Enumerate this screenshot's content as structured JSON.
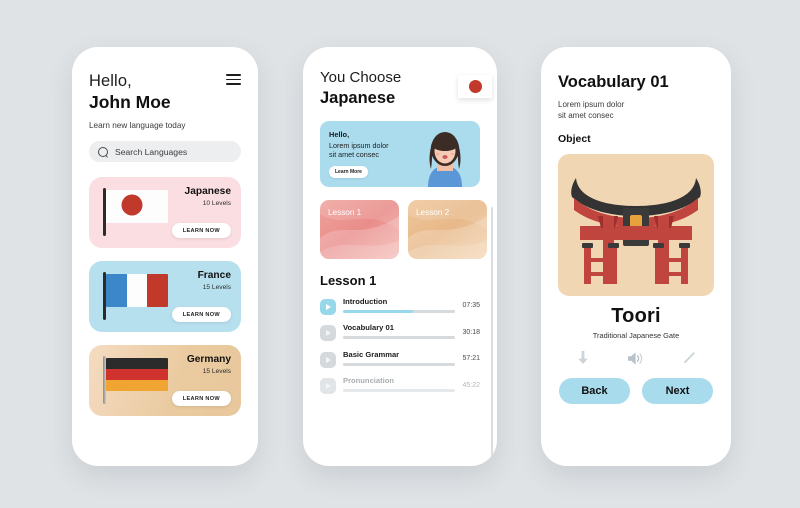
{
  "theme": {
    "background": "#dfe3e6",
    "card_pink": "#fbdee1",
    "card_blue": "#b7e0ef",
    "card_tan": "#eeca9f",
    "accent_blue": "#97d7ea",
    "button_blue": "#a8dced",
    "banner_blue": "#aadcee",
    "image_bg": "#f1d6b4",
    "red": "#c0392b"
  },
  "screen1": {
    "greeting": "Hello,",
    "user_name": "John Moe",
    "tagline": "Learn new language today",
    "menu_icon": "hamburger-menu-icon",
    "search": {
      "icon": "search-icon",
      "placeholder": "Search Languages",
      "value": ""
    },
    "languages": [
      {
        "name": "Japanese",
        "levels": "10 Levels",
        "cta": "LEARN NOW",
        "flag": "japan-flag-icon"
      },
      {
        "name": "France",
        "levels": "15 Levels",
        "cta": "LEARN NOW",
        "flag": "france-flag-icon"
      },
      {
        "name": "Germany",
        "levels": "15 Levels",
        "cta": "LEARN NOW",
        "flag": "germany-flag-icon"
      }
    ]
  },
  "screen2": {
    "title_line1": "You Choose",
    "title_line2": "Japanese",
    "flag_badge": "japan-flag-icon",
    "banner": {
      "heading": "Hello,",
      "body_line1": "Lorem ipsum dolor",
      "body_line2": "sit amet consec",
      "cta": "Learn More",
      "illustration": "woman-avatar"
    },
    "lesson_cards": [
      {
        "label": "Lesson 1"
      },
      {
        "label": "Lesson 2"
      }
    ],
    "section_title": "Lesson 1",
    "lessons": [
      {
        "name": "Introduction",
        "time": "07:35",
        "progress": 62,
        "active": true,
        "dim": false
      },
      {
        "name": "Vocabulary 01",
        "time": "30:18",
        "progress": 0,
        "active": false,
        "dim": false
      },
      {
        "name": "Basic Grammar",
        "time": "57:21",
        "progress": 0,
        "active": false,
        "dim": false
      },
      {
        "name": "Pronunciation",
        "time": "45:22",
        "progress": 0,
        "active": false,
        "dim": true
      }
    ]
  },
  "screen3": {
    "title": "Vocabulary 01",
    "subtitle_line1": "Lorem ipsum dolor",
    "subtitle_line2": "sit amet consec",
    "section_label": "Object",
    "illustration": "torii-gate-illustration",
    "word": "Toori",
    "word_description": "Traditional Japanese Gate",
    "actions": [
      {
        "icon": "download-icon"
      },
      {
        "icon": "speaker-icon"
      },
      {
        "icon": "pencil-edit-icon"
      }
    ],
    "nav": {
      "back": "Back",
      "next": "Next"
    }
  }
}
